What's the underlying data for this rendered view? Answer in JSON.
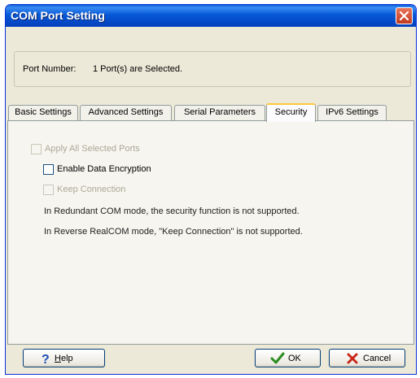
{
  "window": {
    "title": "COM Port Setting",
    "close_icon": "close-icon"
  },
  "port": {
    "label": "Port Number:",
    "value": "1 Port(s) are Selected."
  },
  "tabs": [
    {
      "label": "Basic Settings",
      "active": false
    },
    {
      "label": "Advanced Settings",
      "active": false
    },
    {
      "label": "Serial Parameters",
      "active": false
    },
    {
      "label": "Security",
      "active": true
    },
    {
      "label": "IPv6 Settings",
      "active": false
    }
  ],
  "security": {
    "apply_all": {
      "label": "Apply All Selected Ports",
      "checked": false,
      "enabled": false
    },
    "enable_encryption": {
      "label": "Enable Data Encryption",
      "checked": false,
      "enabled": true
    },
    "keep_connection": {
      "label": "Keep Connection",
      "checked": false,
      "enabled": false
    },
    "notes": [
      "In Redundant COM mode,  the security function is not supported.",
      "In Reverse RealCOM mode, \"Keep Connection\" is not supported."
    ]
  },
  "buttons": {
    "help": {
      "label": "Help",
      "icon": "question-mark-icon"
    },
    "ok": {
      "label": "OK",
      "icon": "checkmark-icon"
    },
    "cancel": {
      "label": "Cancel",
      "icon": "x-cross-icon"
    }
  },
  "colors": {
    "titlebar": "#0758d6",
    "dialog_bg": "#ece9d8",
    "active_tab_accent": "#ffc83c"
  }
}
